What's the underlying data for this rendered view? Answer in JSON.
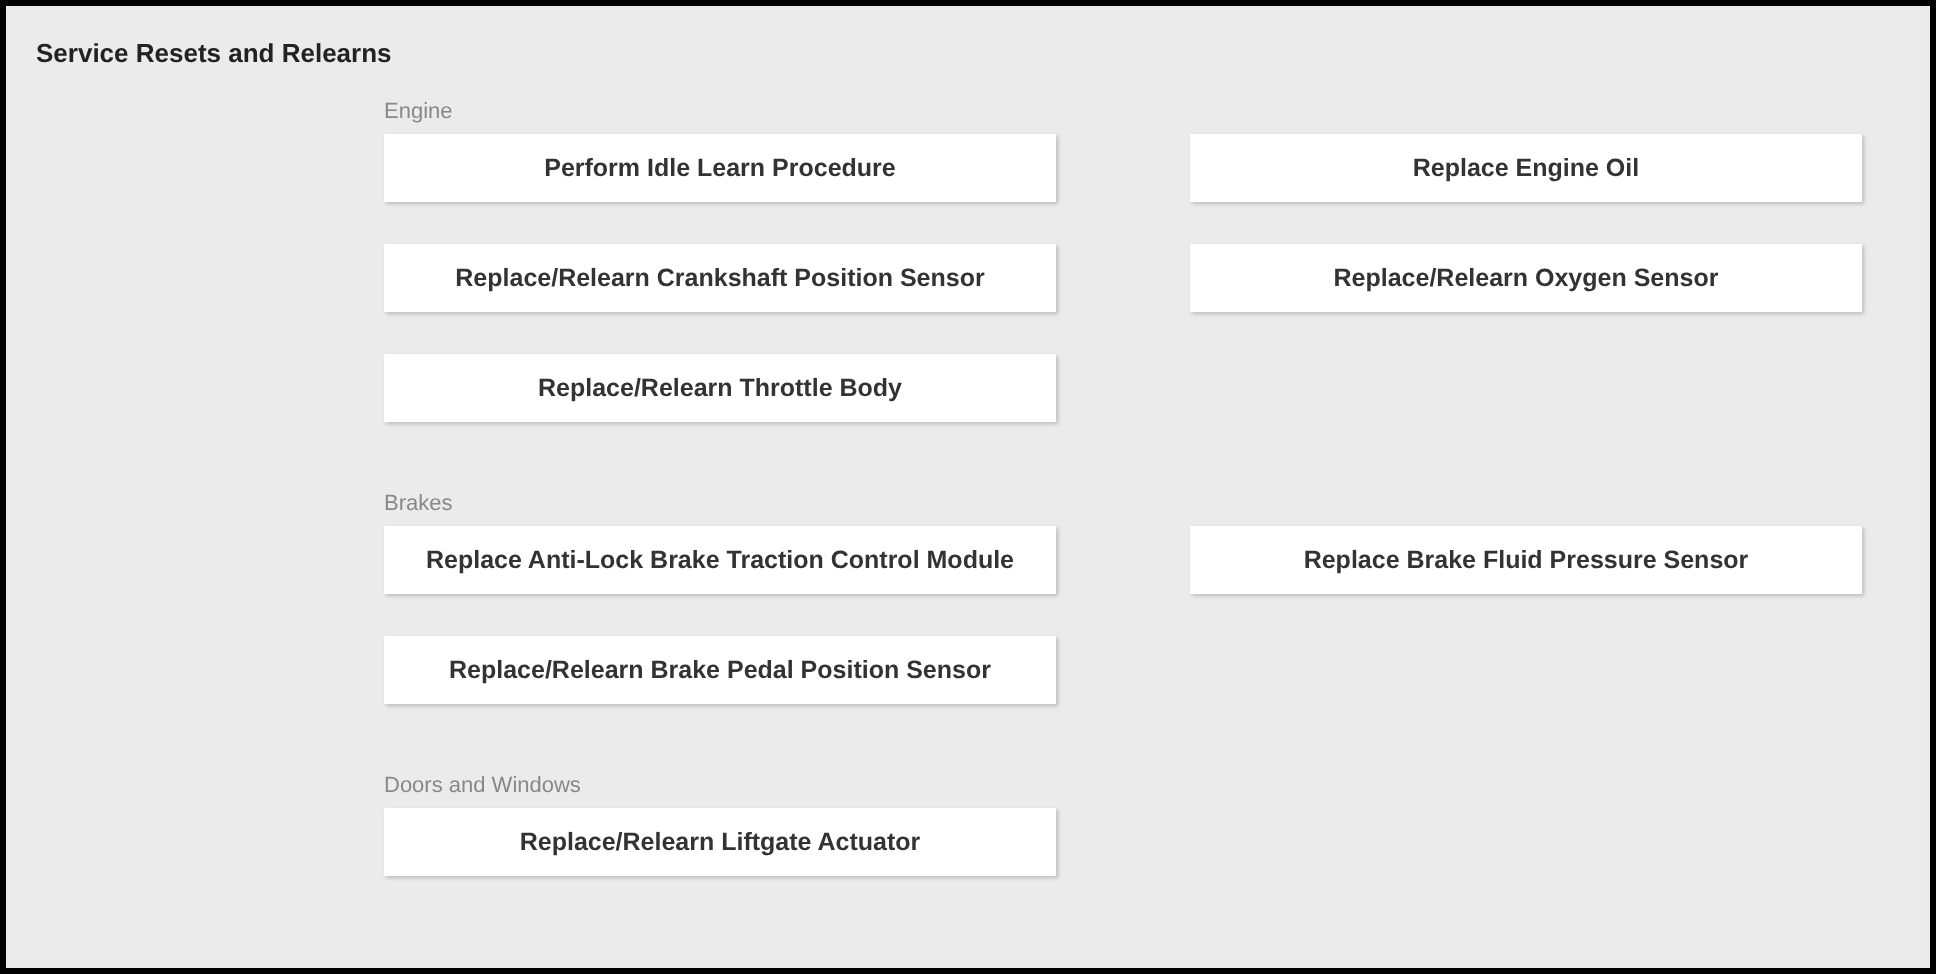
{
  "title": "Service Resets and Relearns",
  "groups": [
    {
      "label": "Engine",
      "buttons": [
        "Perform Idle Learn Procedure",
        "Replace Engine Oil",
        "Replace/Relearn Crankshaft Position Sensor",
        "Replace/Relearn Oxygen Sensor",
        "Replace/Relearn Throttle Body"
      ]
    },
    {
      "label": "Brakes",
      "buttons": [
        "Replace Anti-Lock Brake Traction Control Module",
        "Replace Brake Fluid Pressure Sensor",
        "Replace/Relearn Brake Pedal Position Sensor"
      ]
    },
    {
      "label": "Doors and Windows",
      "buttons": [
        "Replace/Relearn Liftgate Actuator"
      ]
    }
  ]
}
